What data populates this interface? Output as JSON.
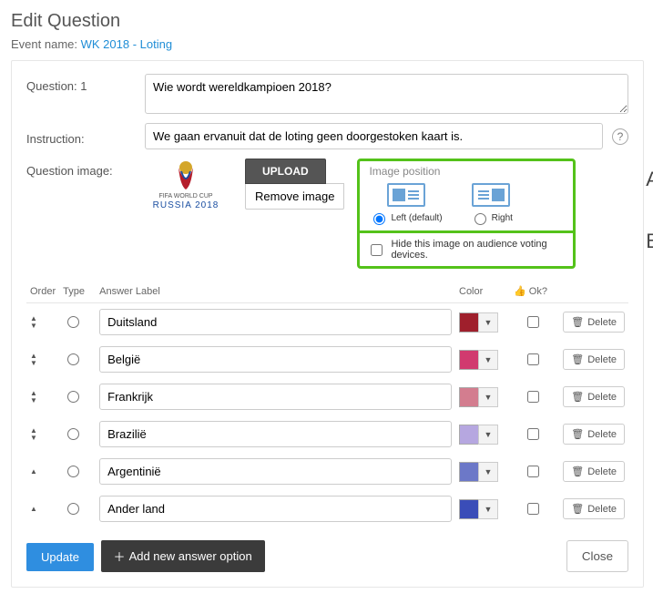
{
  "title": "Edit Question",
  "event_label": "Event name:",
  "event_name": "WK 2018 - Loting",
  "labels": {
    "question": "Question: 1",
    "instruction": "Instruction:",
    "question_image": "Question image:"
  },
  "question_text": "Wie wordt wereldkampioen 2018?",
  "instruction_text": "We gaan ervanuit dat de loting geen doorgestoken kaart is.",
  "image": {
    "fifa": "FIFA WORLD CUP",
    "russia": "RUSSIA 2018",
    "upload": "UPLOAD",
    "remove": "Remove image"
  },
  "img_position": {
    "title": "Image position",
    "left": "Left (default)",
    "right": "Right",
    "selected": "left",
    "hide_label": "Hide this image on audience voting devices."
  },
  "annotations": {
    "a": "A.",
    "b": "B."
  },
  "table": {
    "headers": {
      "order": "Order",
      "type": "Type",
      "label": "Answer Label",
      "color": "Color",
      "ok": "Ok?",
      "ok_icon": "👍"
    },
    "answers": [
      {
        "label": "Duitsland",
        "color": "#9f1f2c",
        "up": true,
        "down": true
      },
      {
        "label": "België",
        "color": "#d13a6f",
        "up": true,
        "down": true
      },
      {
        "label": "Frankrijk",
        "color": "#d37d8f",
        "up": true,
        "down": true
      },
      {
        "label": "Brazilië",
        "color": "#b6a7e0",
        "up": true,
        "down": true
      },
      {
        "label": "Argentinië",
        "color": "#6c78c8",
        "up": true,
        "down": false
      },
      {
        "label": "Ander land",
        "color": "#3a4db8",
        "up": true,
        "down": false
      }
    ],
    "delete": "Delete"
  },
  "buttons": {
    "update": "Update",
    "add": "Add new answer option",
    "close": "Close"
  }
}
